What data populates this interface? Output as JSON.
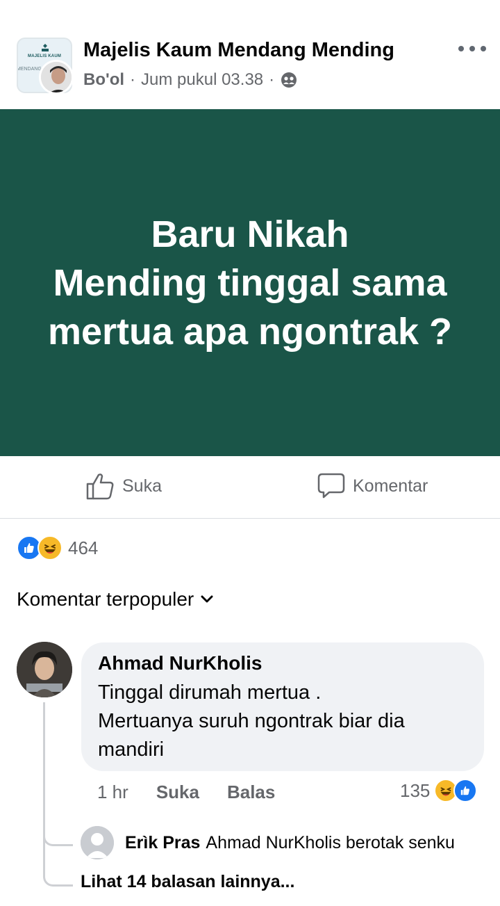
{
  "post": {
    "group_name": "Majelis Kaum Mendang Mending",
    "group_logo_text": "MAJELIS KAUM",
    "group_logo_subtext": "MENDANG",
    "author": "Bo'ol",
    "separator": "·",
    "timestamp": "Jum pukul 03.38",
    "privacy_icon": "group-members-icon",
    "banner_lines": [
      "Baru Nikah",
      "Mending tinggal sama",
      "mertua apa ngontrak ?"
    ],
    "banner_color": "#1a5548"
  },
  "actions": {
    "like_label": "Suka",
    "comment_label": "Komentar"
  },
  "reactions": {
    "icons": [
      "like-reaction-icon",
      "haha-reaction-icon"
    ],
    "count": "464"
  },
  "comments_sort": {
    "label": "Komentar terpopuler"
  },
  "comment": {
    "author": "Ahmad NurKholis",
    "text_lines": [
      "Tinggal dirumah mertua .",
      "Mertuanya suruh ngontrak biar dia",
      "mandiri"
    ],
    "time": "1 hr",
    "like_label": "Suka",
    "reply_label": "Balas",
    "reaction_count": "135"
  },
  "reply": {
    "author": "Erìk Pras",
    "text": "Ahmad NurKholis berotak senku"
  },
  "more_replies_label": "Lihat 14 balasan lainnya...",
  "colors": {
    "like_blue": "#1877f2",
    "haha_yellow": "#f7b928",
    "secondary_text": "#65676b"
  }
}
